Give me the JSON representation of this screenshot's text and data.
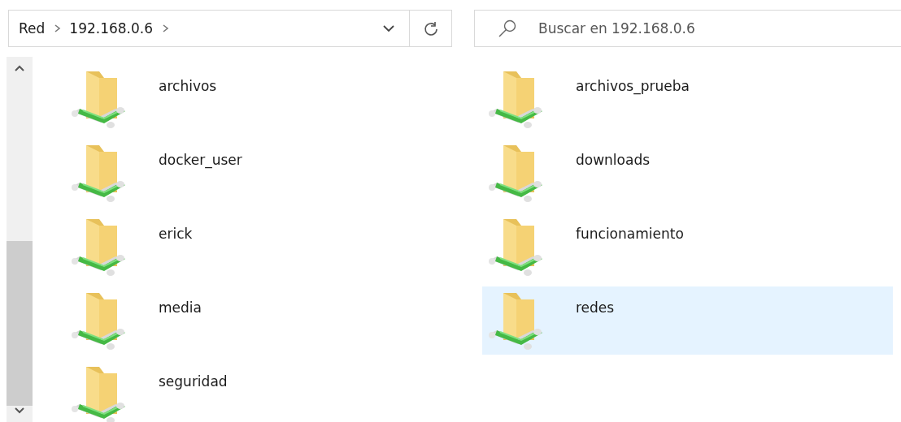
{
  "address_bar": {
    "breadcrumbs": [
      "Red",
      "192.168.0.6"
    ]
  },
  "search": {
    "placeholder": "Buscar en 192.168.0.6"
  },
  "items": [
    {
      "label": "archivos",
      "selected": false
    },
    {
      "label": "archivos_prueba",
      "selected": false
    },
    {
      "label": "docker_user",
      "selected": false
    },
    {
      "label": "downloads",
      "selected": false
    },
    {
      "label": "erick",
      "selected": false
    },
    {
      "label": "funcionamiento",
      "selected": false
    },
    {
      "label": "media",
      "selected": false
    },
    {
      "label": "redes",
      "selected": true
    },
    {
      "label": "seguridad",
      "selected": false
    }
  ]
}
